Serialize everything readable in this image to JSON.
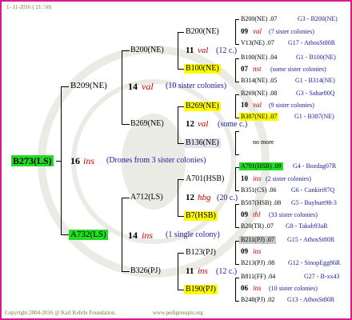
{
  "header": {
    "date": "1- 11-2016 ( 21: 50)"
  },
  "footer": {
    "copyright": "Copyright 2004-2016 @ Karl Kehrle Foundation.",
    "site": "www.pedigreeapis.org"
  },
  "colors": {
    "frame": "#d81b8e",
    "green": "#22dd22",
    "yellow": "#ffff00",
    "gray": "#c8c8c8",
    "red": "#cc0000",
    "blue": "#1a1aa0"
  },
  "root": {
    "id": "B273(LS)",
    "num": "16",
    "tag": "ins",
    "note": "(Drones from 3 sister colonies)"
  },
  "g1": [
    {
      "id": "B209(NE)",
      "num": "14",
      "tag": "val",
      "note": "(10 sister colonies)"
    },
    {
      "id": "A732(LS)",
      "num": "14",
      "tag": "ins",
      "note": "(1 single colony)"
    }
  ],
  "g2": [
    {
      "id": "B200(NE)",
      "num": "11",
      "tag": "val",
      "note": "(12 c.)"
    },
    {
      "id": "B269(NE)",
      "num": "12",
      "tag": "val",
      "note": "(some c.)"
    },
    {
      "id": "A712(LS)",
      "num": "12",
      "tag": "hbg",
      "note": "(20 c.)"
    },
    {
      "id": "B326(PJ)",
      "num": "11",
      "tag": "ins",
      "note": "(12 c.)"
    }
  ],
  "g3": [
    {
      "id": "B200(NE)"
    },
    {
      "id": "B100(NE)"
    },
    {
      "id": "B269(NE)"
    },
    {
      "id": "B136(NE)"
    },
    {
      "id": "A701(HSB)"
    },
    {
      "id": "B7(HSB)"
    },
    {
      "id": "B123(PJ)"
    },
    {
      "id": "B190(PJ)"
    }
  ],
  "g4": [
    {
      "top": "B200(NE) .07",
      "topLink": "G3 - B200(NE)",
      "num": "09",
      "tag": "val",
      "note": "(7 sister colonies)",
      "bot": "V13(NE) .07",
      "botLink": "G17 - AthosSt80R"
    },
    {
      "top": "B100(NE) .04",
      "topLink": "G1 - B100(NE)",
      "num": "07",
      "tag": "nst",
      "note": "(some sister colonies)",
      "bot": "B314(NE) .05",
      "botLink": "G1 - B314(NE)"
    },
    {
      "top": "B269(NE) .08",
      "topLink": "G3 - Sahar00Q",
      "num": "10",
      "tag": "val",
      "note": "(9 sister colonies)",
      "bot": "B387(NE) .07",
      "botLink": "G1 - B387(NE)"
    },
    {
      "nomore": "no more"
    },
    {
      "top": "A701(HSB) .09",
      "topLink": "G4 - Bozdag07R",
      "num": "10",
      "tag": "ins",
      "note": "(2 sister colonies)",
      "bot": "B351(CS) .06",
      "botLink": "G6 - Cankiri97Q"
    },
    {
      "top": "B507(HSB) .08",
      "topLink": "G5 - Bayburt98-3",
      "num": "09",
      "tag": "thl",
      "note": "(33 sister colonies)",
      "bot": "B20(TR) .07",
      "botLink": "G8 - Takab93aR"
    },
    {
      "top": "B211(PJ) .07",
      "topLink": "G15 - AthosSt80R",
      "num": "09",
      "tag": "ins",
      "note": "",
      "bot": "B213(PJ) .08",
      "botLink": "G12 - SinopEgg86R"
    },
    {
      "top": "B811(FF) .04",
      "topLink": "G27 - B-xx43",
      "num": "06",
      "tag": "ins",
      "note": "(10 sister colonies)",
      "bot": "B248(PJ) .02",
      "botLink": "G13 - AthosSt80R"
    }
  ]
}
